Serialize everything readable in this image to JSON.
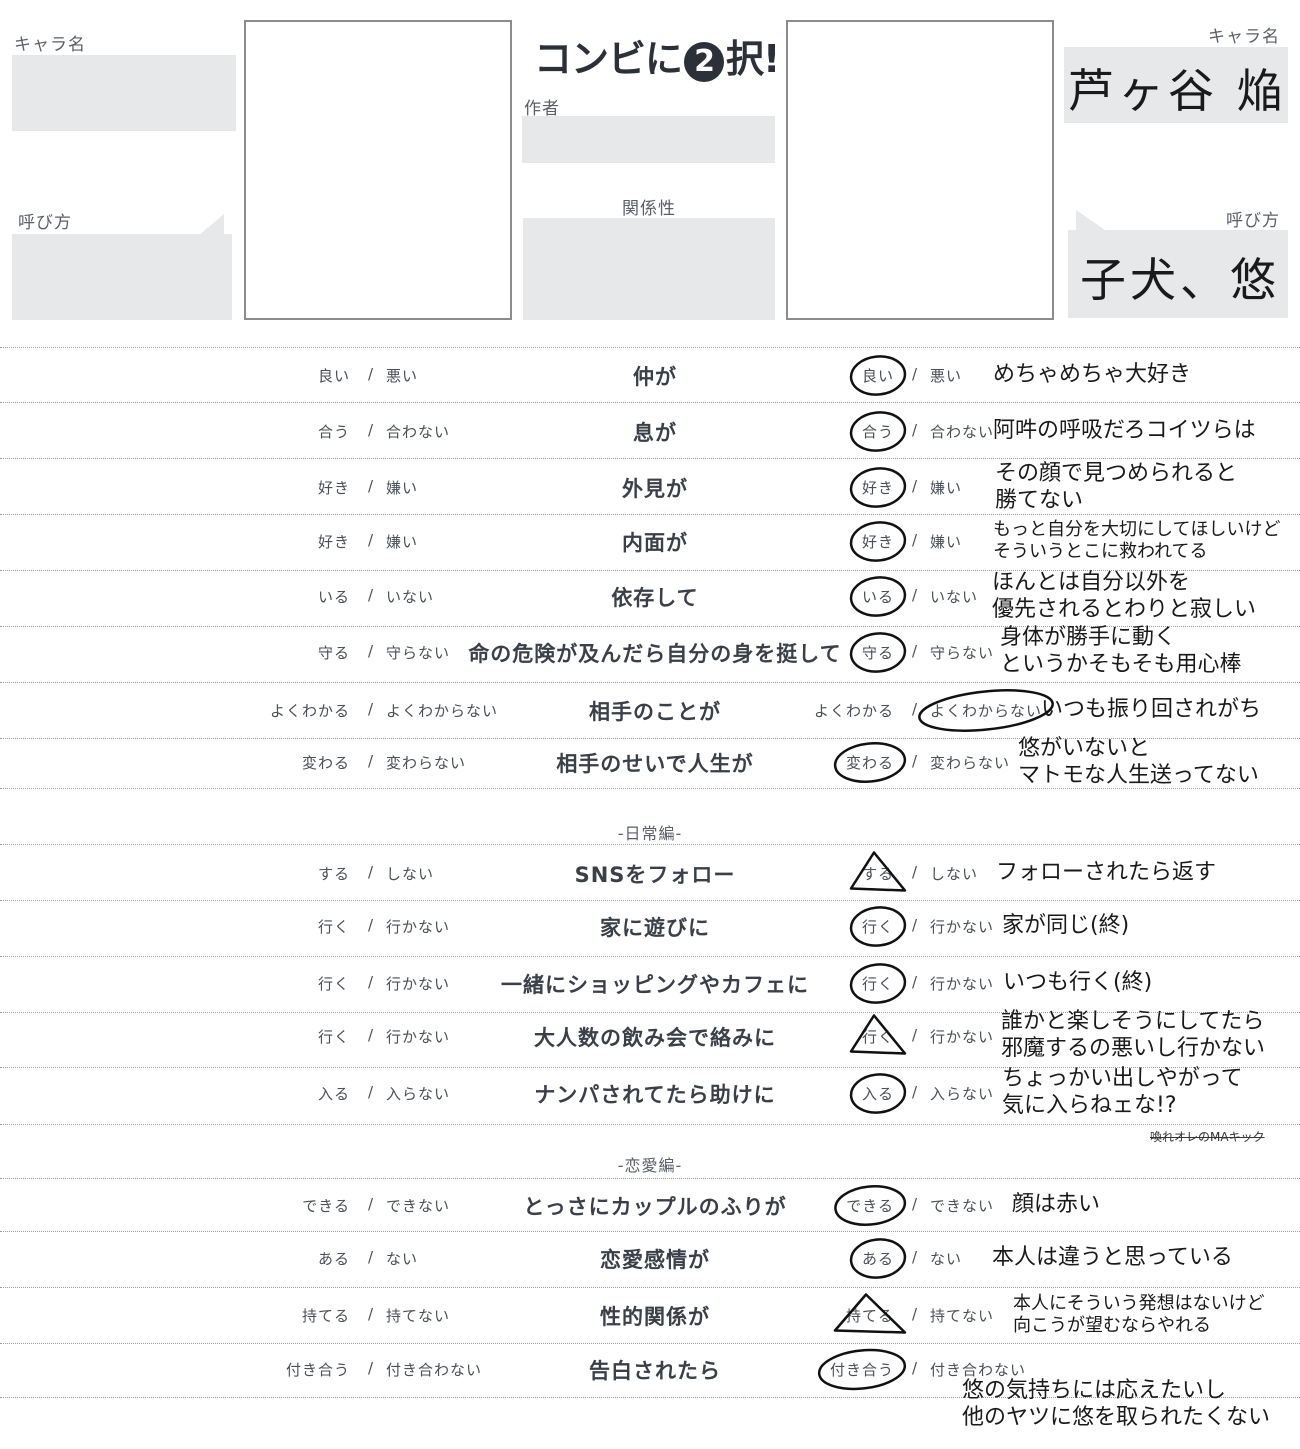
{
  "header": {
    "title_prefix": "コンビに",
    "title_number": "2",
    "title_suffix": "択!",
    "left_name_label": "キャラ名",
    "left_call_label": "呼び方",
    "author_label": "作者",
    "relation_label": "関係性",
    "right_name_label": "キャラ名",
    "right_name_value": "芦ヶ谷 焔",
    "right_call_label": "呼び方",
    "right_call_value": "子犬、悠"
  },
  "sections": {
    "daily": "-日常編-",
    "love": "-恋愛編-"
  },
  "rows": [
    {
      "a": "良い",
      "b": "悪い",
      "q": "仲が",
      "pick": "a",
      "mark": "circle",
      "ans": [
        "めちゃめちゃ大好き"
      ]
    },
    {
      "a": "合う",
      "b": "合わない",
      "q": "息が",
      "pick": "a",
      "mark": "circle",
      "ans": [
        "阿吽の呼吸だろコイツらは"
      ]
    },
    {
      "a": "好き",
      "b": "嫌い",
      "q": "外見が",
      "pick": "a",
      "mark": "circle",
      "ans": [
        "その顔で見つめられると",
        "勝てない"
      ]
    },
    {
      "a": "好き",
      "b": "嫌い",
      "q": "内面が",
      "pick": "a",
      "mark": "circle",
      "ans": [
        "もっと自分を大切にしてほしいけど",
        "そういうとこに救われてる"
      ]
    },
    {
      "a": "いる",
      "b": "いない",
      "q": "依存して",
      "pick": "a",
      "mark": "circle",
      "ans": [
        "ほんとは自分以外を",
        "優先されるとわりと寂しい"
      ]
    },
    {
      "a": "守る",
      "b": "守らない",
      "q": "命の危険が及んだら自分の身を挺して",
      "pick": "a",
      "mark": "circle",
      "ans": [
        "身体が勝手に動く",
        "というかそもそも用心棒"
      ]
    },
    {
      "a": "よくわかる",
      "b": "よくわからない",
      "q": "相手のことが",
      "pick": "b",
      "mark": "circle",
      "ans": [
        "いつも振り回されがち"
      ]
    },
    {
      "a": "変わる",
      "b": "変わらない",
      "q": "相手のせいで人生が",
      "pick": "a",
      "mark": "circle",
      "ans": [
        "悠がいないと",
        "マトモな人生送ってない"
      ]
    },
    {
      "a": "する",
      "b": "しない",
      "q": "SNSをフォロー",
      "pick": "a",
      "mark": "triangle",
      "ans": [
        "フォローされたら返す"
      ]
    },
    {
      "a": "行く",
      "b": "行かない",
      "q": "家に遊びに",
      "pick": "a",
      "mark": "circle",
      "ans": [
        "家が同じ(終)"
      ]
    },
    {
      "a": "行く",
      "b": "行かない",
      "q": "一緒にショッピングやカフェに",
      "pick": "a",
      "mark": "circle",
      "ans": [
        "いつも行く(終)"
      ]
    },
    {
      "a": "行く",
      "b": "行かない",
      "q": "大人数の飲み会で絡みに",
      "pick": "a",
      "mark": "triangle",
      "ans": [
        "誰かと楽しそうにしてたら",
        "邪魔するの悪いし行かない"
      ]
    },
    {
      "a": "入る",
      "b": "入らない",
      "q": "ナンパされてたら助けに",
      "pick": "a",
      "mark": "circle",
      "ans": [
        "ちょっかい出しやがって",
        "気に入らねェな!?"
      ]
    },
    {
      "a": "できる",
      "b": "できない",
      "q": "とっさにカップルのふりが",
      "pick": "a",
      "mark": "circle",
      "ans": [
        "顔は赤い"
      ]
    },
    {
      "a": "ある",
      "b": "ない",
      "q": "恋愛感情が",
      "pick": "a",
      "mark": "circle",
      "ans": [
        "本人は違うと思っている"
      ]
    },
    {
      "a": "持てる",
      "b": "持てない",
      "q": "性的関係が",
      "pick": "a",
      "mark": "triangle",
      "ans": [
        "本人にそういう発想はないけど",
        "向こうが望むならやれる"
      ]
    },
    {
      "a": "付き合う",
      "b": "付き合わない",
      "q": "告白されたら",
      "pick": "a",
      "mark": "circle",
      "ans": [
        "悠の気持ちには応えたいし",
        "他のヤツに悠を取られたくない"
      ]
    }
  ],
  "note_struck": "喚れオレのMAキック"
}
